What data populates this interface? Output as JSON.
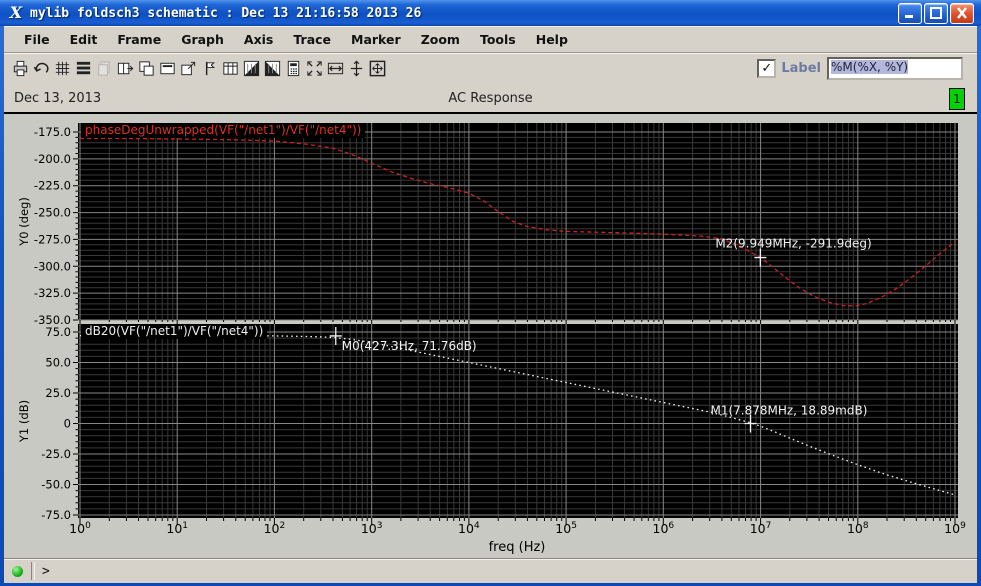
{
  "window": {
    "title": "mylib foldsch3 schematic : Dec 13 21:16:58 2013 26",
    "icon_glyph": "X",
    "controls": {
      "minimize": "minimize",
      "maximize": "maximize",
      "close": "close"
    }
  },
  "menu": {
    "items": [
      "File",
      "Edit",
      "Frame",
      "Graph",
      "Axis",
      "Trace",
      "Marker",
      "Zoom",
      "Tools",
      "Help"
    ]
  },
  "toolbar": {
    "icons": [
      {
        "name": "print-icon",
        "disabled": false
      },
      {
        "name": "undo-icon",
        "disabled": false
      },
      {
        "name": "grid-icon",
        "disabled": false
      },
      {
        "name": "strip-chart-icon",
        "disabled": false
      },
      {
        "name": "copy-icon",
        "disabled": true
      },
      {
        "name": "split-strip-icon",
        "disabled": false
      },
      {
        "name": "new-subwindow-icon",
        "disabled": false
      },
      {
        "name": "delete-subwindow-icon",
        "disabled": false
      },
      {
        "name": "pop-out-subwindow-icon",
        "disabled": false
      },
      {
        "name": "vertical-marker-icon",
        "disabled": false
      },
      {
        "name": "table-icon",
        "disabled": false
      },
      {
        "name": "update-mode-icon",
        "disabled": false
      },
      {
        "name": "refresh-mode-icon",
        "disabled": false
      },
      {
        "name": "calculator-icon",
        "disabled": false
      },
      {
        "name": "fit-icon",
        "disabled": false
      },
      {
        "name": "fit-x-icon",
        "disabled": false
      },
      {
        "name": "fit-y-icon",
        "disabled": false
      },
      {
        "name": "fit-window-icon",
        "disabled": false
      }
    ],
    "checkbox_glyph": "✓",
    "label_text": "Label",
    "label_input_value": "%M(%X, %Y)"
  },
  "header": {
    "date": "Dec 13, 2013",
    "title": "AC Response",
    "badge": "1"
  },
  "statusbar": {
    "prompt": ">"
  },
  "colors": {
    "titlebar_blue": "#0f55c8",
    "close_red": "#dd4f2a",
    "badge_green": "#00d400",
    "canvas_bg": "#000000",
    "grid_major": "#878787",
    "grid_minor": "#383838",
    "trace_phase": "#cc2222",
    "trace_magnitude": "#f2f2f2",
    "marker_white": "#f2f2f2",
    "axis_text": "#000000"
  },
  "chart_data": [
    {
      "type": "line",
      "title": "phaseDegUnwrapped(VF(\"/net1\")/VF(\"/net4\"))",
      "ylabel": "Y0 (deg)",
      "x_scale": "log",
      "xlim_log10": [
        0,
        9
      ],
      "ylim": [
        -350,
        -175
      ],
      "grid": true,
      "y_ticks": [
        -175,
        -200,
        -225,
        -250,
        -275,
        -300,
        -325,
        -350
      ],
      "y_tick_labels": [
        "-175.0",
        "-200.0",
        "-225.0",
        "-250.0",
        "-275.0",
        "-300.0",
        "-325.0",
        "-350.0"
      ],
      "series": [
        {
          "name": "phaseDegUnwrapped(VF(\"/net1\")/VF(\"/net4\"))",
          "color": "#cc2222",
          "line_style": "dashed",
          "points": [
            [
              0,
              -181
            ],
            [
              0.4,
              -181
            ],
            [
              0.8,
              -181.3
            ],
            [
              1.2,
              -181.7
            ],
            [
              1.6,
              -182.3
            ],
            [
              2.0,
              -183.5
            ],
            [
              2.3,
              -186
            ],
            [
              2.6,
              -190
            ],
            [
              2.8,
              -196
            ],
            [
              3.0,
              -204
            ],
            [
              3.2,
              -212
            ],
            [
              3.4,
              -218
            ],
            [
              3.6,
              -223
            ],
            [
              3.8,
              -227
            ],
            [
              4.0,
              -232
            ],
            [
              4.15,
              -239
            ],
            [
              4.3,
              -249
            ],
            [
              4.45,
              -258
            ],
            [
              4.6,
              -263
            ],
            [
              4.8,
              -266
            ],
            [
              5.0,
              -267.5
            ],
            [
              5.4,
              -268.5
            ],
            [
              5.8,
              -269.5
            ],
            [
              6.1,
              -270.5
            ],
            [
              6.4,
              -272
            ],
            [
              6.6,
              -274.5
            ],
            [
              6.8,
              -282
            ],
            [
              7.0,
              -291.9
            ],
            [
              7.1,
              -299
            ],
            [
              7.25,
              -310
            ],
            [
              7.4,
              -320
            ],
            [
              7.55,
              -328
            ],
            [
              7.7,
              -333.5
            ],
            [
              7.85,
              -336.5
            ],
            [
              7.98,
              -337
            ],
            [
              8.1,
              -334.5
            ],
            [
              8.25,
              -328.5
            ],
            [
              8.4,
              -320.5
            ],
            [
              8.55,
              -310.5
            ],
            [
              8.7,
              -299.5
            ],
            [
              8.85,
              -288
            ],
            [
              9.0,
              -277
            ]
          ]
        }
      ],
      "markers": [
        {
          "label": "M2(9.949MHz, -291.9deg)",
          "x_log10": 6.9978,
          "y": -291.9,
          "dx": -45,
          "dy": -10
        }
      ]
    },
    {
      "type": "line",
      "title": "dB20(VF(\"/net1\")/VF(\"/net4\"))",
      "ylabel": "Y1 (dB)",
      "xlabel": "freq (Hz)",
      "x_scale": "log",
      "xlim_log10": [
        0,
        9
      ],
      "ylim": [
        -75,
        75
      ],
      "grid": true,
      "x_tick_base": "10",
      "x_tick_exponents": [
        0,
        1,
        2,
        3,
        4,
        5,
        6,
        7,
        8,
        9
      ],
      "y_ticks": [
        75,
        50,
        25,
        0,
        -25,
        -50,
        -75
      ],
      "y_tick_labels": [
        "75.0",
        "50.0",
        "25.0",
        "0",
        "-25.0",
        "-50.0",
        "-75.0"
      ],
      "series": [
        {
          "name": "dB20(VF(\"/net1\")/VF(\"/net4\"))",
          "color": "#f2f2f2",
          "line_style": "dotted",
          "points": [
            [
              0,
              72
            ],
            [
              0.5,
              72
            ],
            [
              1.0,
              72
            ],
            [
              1.5,
              71.95
            ],
            [
              2.0,
              71.8
            ],
            [
              2.3,
              71.4
            ],
            [
              2.5,
              71.0
            ],
            [
              2.65,
              70.2
            ],
            [
              2.8,
              68.9
            ],
            [
              3.0,
              66.4
            ],
            [
              3.25,
              62.3
            ],
            [
              3.5,
              58.2
            ],
            [
              3.75,
              54.1
            ],
            [
              4.0,
              50.0
            ],
            [
              4.25,
              45.9
            ],
            [
              4.5,
              41.8
            ],
            [
              4.75,
              37.7
            ],
            [
              5.0,
              33.6
            ],
            [
              5.25,
              29.5
            ],
            [
              5.5,
              25.4
            ],
            [
              5.75,
              21.3
            ],
            [
              6.0,
              17.2
            ],
            [
              6.25,
              13.1
            ],
            [
              6.5,
              9.0
            ],
            [
              6.7,
              4.9
            ],
            [
              6.9,
              0.5
            ],
            [
              7.0,
              -2.2
            ],
            [
              7.15,
              -7.0
            ],
            [
              7.3,
              -12.0
            ],
            [
              7.5,
              -18.5
            ],
            [
              7.75,
              -26.3
            ],
            [
              8.0,
              -33.8
            ],
            [
              8.25,
              -40.8
            ],
            [
              8.5,
              -47.0
            ],
            [
              8.75,
              -52.8
            ],
            [
              9.0,
              -58.5
            ]
          ]
        }
      ],
      "markers": [
        {
          "label": "M0(427.3Hz, 71.76dB)",
          "x_log10": 2.6307,
          "y": 71.76,
          "dx": 6,
          "dy": 14
        },
        {
          "label": "M1(7.878MHz, 18.89mdB)",
          "x_log10": 6.8964,
          "y": 0.0189,
          "dx": -40,
          "dy": -9
        }
      ]
    }
  ]
}
